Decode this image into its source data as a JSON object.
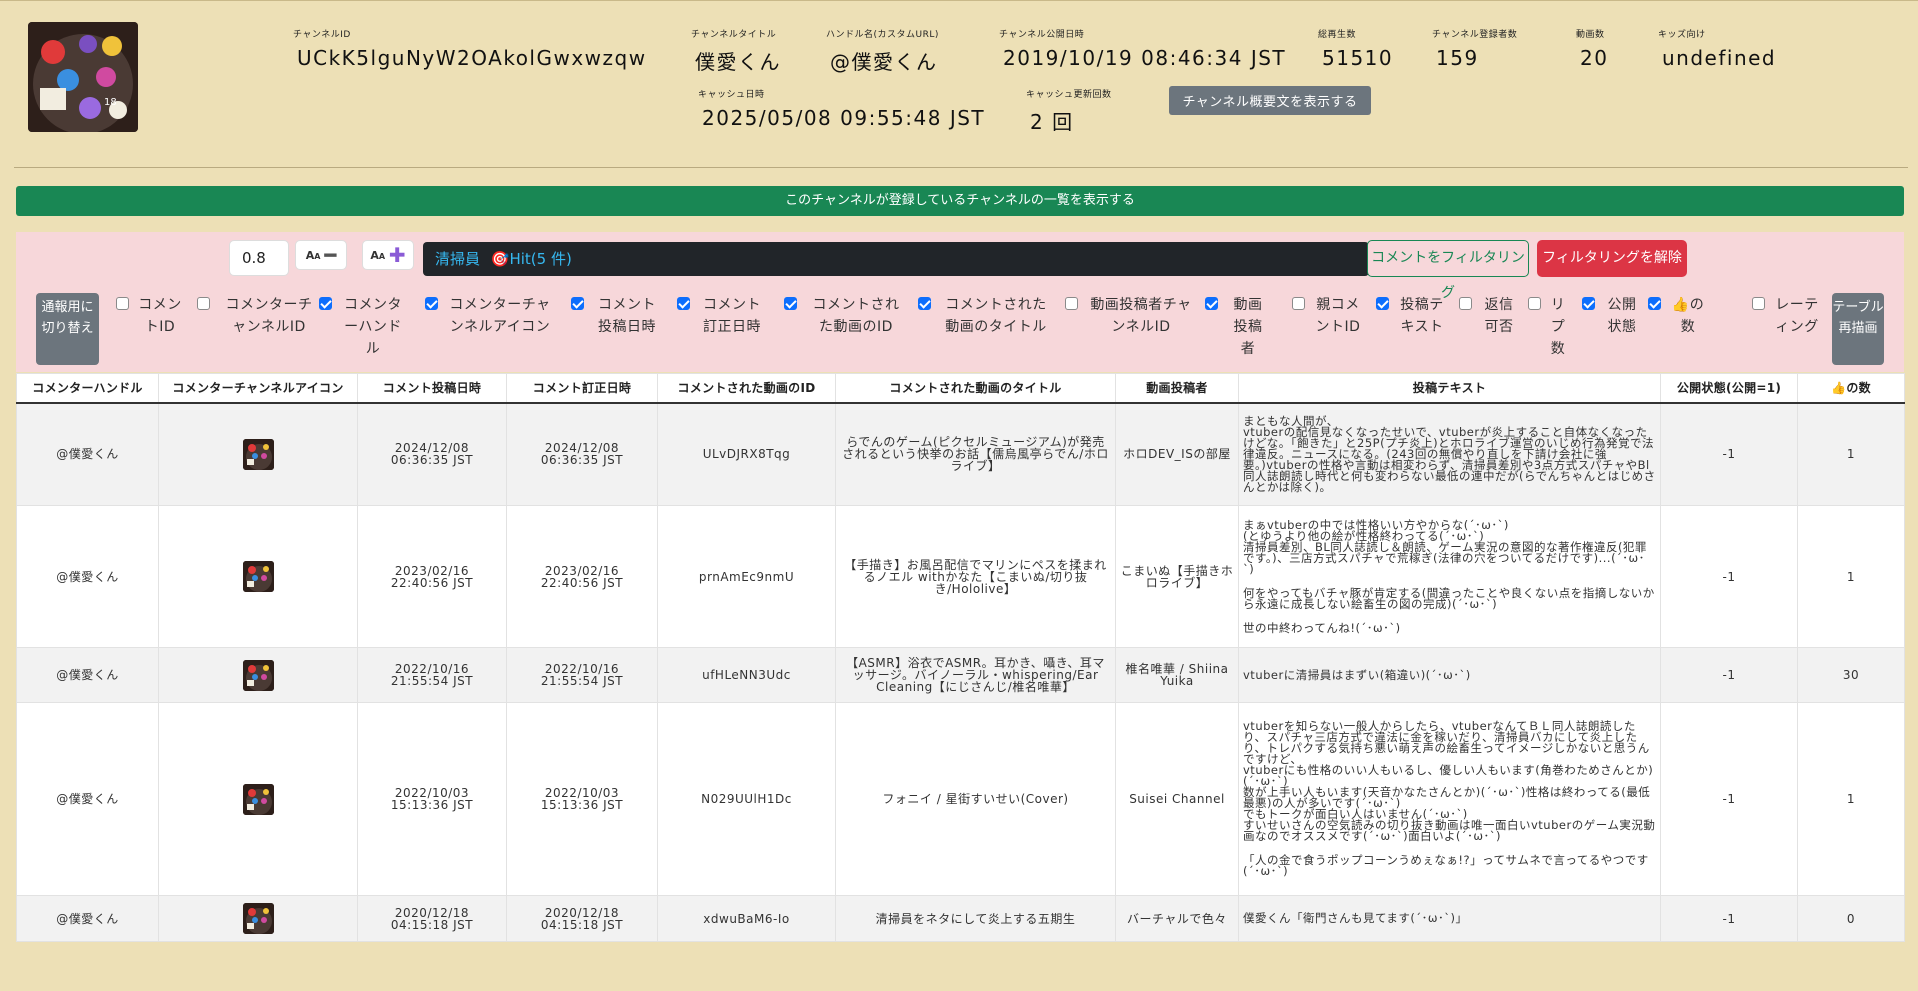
{
  "header": {
    "channel_id_label": "チャンネルID",
    "channel_id": "UCkK5lguNyW2OAkolGwxwzqw",
    "channel_title_label": "チャンネルタイトル",
    "channel_title": "僕愛くん",
    "handle_label": "ハンドル名(カスタムURL)",
    "handle": "@僕愛くん",
    "published_label": "チャンネル公開日時",
    "published": "2019/10/19 08:46:34 JST",
    "views_label": "総再生数",
    "views": "51510",
    "subscribers_label": "チャンネル登録者数",
    "subscribers": "159",
    "videos_label": "動画数",
    "videos": "20",
    "kids_label": "キッズ向け",
    "kids": "undefined",
    "cache_label": "キャッシュ日時",
    "cache": "2025/05/08 09:55:48 JST",
    "cache_count_label": "キャッシュ更新回数",
    "cache_count": "2 回",
    "desc_button": "チャンネル概要文を表示する"
  },
  "subscriptions_bar": "このチャンネルが登録しているチャンネルの一覧を表示する",
  "filter": {
    "zoom_value": "0.8",
    "font_small_label": "A",
    "font_large_label": "A",
    "search_term": "清掃員",
    "hit_text": "🎯Hit(5 件)",
    "filter_button": "コメントをフィルタリング",
    "clear_button": "フィルタリングを解除",
    "report_toggle": "通報用に切り替え",
    "redraw_button": "テーブル再描画",
    "columns": [
      {
        "label": "コメントID",
        "checked": false
      },
      {
        "label": "コメンターチャンネルID",
        "checked": false
      },
      {
        "label": "コメンターハンドル",
        "checked": true
      },
      {
        "label": "コメンターチャンネルアイコン",
        "checked": true
      },
      {
        "label": "コメント投稿日時",
        "checked": true
      },
      {
        "label": "コメント訂正日時",
        "checked": true
      },
      {
        "label": "コメントされた動画のID",
        "checked": true
      },
      {
        "label": "コメントされた動画のタイトル",
        "checked": true
      },
      {
        "label": "動画投稿者チャンネルID",
        "checked": false
      },
      {
        "label": "動画投稿者",
        "checked": true
      },
      {
        "label": "親コメントID",
        "checked": false
      },
      {
        "label": "投稿テキスト",
        "checked": true
      },
      {
        "label": "返信可否",
        "checked": false
      },
      {
        "label": "リプ数",
        "checked": false
      },
      {
        "label": "公開状態",
        "checked": true
      },
      {
        "label": "👍の数",
        "checked": true
      },
      {
        "label": "レーティング",
        "checked": false
      }
    ]
  },
  "table": {
    "headers": [
      "コメンターハンドル",
      "コメンターチャンネルアイコン",
      "コメント投稿日時",
      "コメント訂正日時",
      "コメントされた動画のID",
      "コメントされた動画のタイトル",
      "動画投稿者",
      "投稿テキスト",
      "公開状態(公開=1)",
      "👍の数"
    ],
    "rows": [
      {
        "handle": "@僕愛くん",
        "posted": [
          "2024/12/08",
          "06:36:35 JST"
        ],
        "edited": [
          "2024/12/08",
          "06:36:35 JST"
        ],
        "video_id": "ULvDJRX8Tqg",
        "video_title": "らでんのゲーム(ピクセルミュージアム)が発売されるという快挙のお話【儒烏風亭らでん/ホロライブ】",
        "uploader": "ホロDEV_ISの部屋",
        "text": [
          "まともな人間が、",
          "vtuberの配信見なくなったせいで、vtuberが炎上すること自体なくなったけどな。「飽きた」と25P(プチ炎上)とホロライブ運営のいじめ行為発覚で法律違反。ニュースになる。(243回の無償やり直しを下請け会社に強要。)vtuberの性格や言動は相変わらず、清掃員差別や3点方式スパチャやBl同人誌朗読し時代と何も変わらない最低の連中だが(らでんちゃんとはじめさんとかは除く)。"
        ],
        "status": "-1",
        "likes": "1"
      },
      {
        "handle": "@僕愛くん",
        "posted": [
          "2023/02/16",
          "22:40:56 JST"
        ],
        "edited": [
          "2023/02/16",
          "22:40:56 JST"
        ],
        "video_id": "prnAmEc9nmU",
        "video_title": "【手描き】お風呂配信でマリンにペスを揉まれるノエル withかなた【こまいぬ/切り抜き/Hololive】",
        "uploader": "こまいぬ【手描きホロライブ】",
        "text": [
          "まぁvtuberの中では性格いい方やからな(´･ω･`)",
          "(とゆうより他の絵が性格終わってる(´･ω･`)",
          "清掃員差別、BL同人誌読し＆朗読、ゲーム実況の意図的な著作権違反(犯罪です。)、三店方式スパチャで荒稼ぎ(法律の穴をついてるだけです)...(´･ω･`)",
          "",
          "何をやってもバチャ豚が肯定する(間違ったことや良くない点を指摘しないから永遠に成長しない絵畜生の図の完成)(´･ω･`)",
          "",
          "世の中終わってんね!(´･ω･`)"
        ],
        "status": "-1",
        "likes": "1"
      },
      {
        "handle": "@僕愛くん",
        "posted": [
          "2022/10/16",
          "21:55:54 JST"
        ],
        "edited": [
          "2022/10/16",
          "21:55:54 JST"
        ],
        "video_id": "ufHLeNN3Udc",
        "video_title": "【ASMR】浴衣でASMR。耳かき、囁き、耳マッサージ。バイノーラル・whispering/Ear Cleaning【にじさんじ/椎名唯華】",
        "uploader": "椎名唯華 / Shiina Yuika",
        "text": [
          "vtuberに清掃員はまずい(箱違い)(´･ω･`)"
        ],
        "status": "-1",
        "likes": "30"
      },
      {
        "handle": "@僕愛くん",
        "posted": [
          "2022/10/03",
          "15:13:36 JST"
        ],
        "edited": [
          "2022/10/03",
          "15:13:36 JST"
        ],
        "video_id": "N029UUlH1Dc",
        "video_title": "フォニイ / 星街すいせい(Cover)",
        "uploader": "Suisei Channel",
        "text": [
          "vtuberを知らない一般人からしたら、vtuberなんてＢＬ同人誌朗読したり、スパチャ三店方式で違法に金を稼いだり、清掃員バカにして炎上したり、トレパクする気持ち悪い萌え声の絵畜生ってイメージしかないと思うんですけど、",
          "vtuberにも性格のいい人もいるし、優しい人もいます(角巻わためさんとか)(´･ω･`)",
          "数が上手い人もいます(天音かなたさんとか)(´･ω･`)性格は終わってる(最低最悪)の人が多いです(´･ω･`)",
          "でもトークが面白い人はいません(´･ω･`)",
          "すいせいさんの空気読みの切り抜き動画は唯一面白いvtuberのゲーム実況動画なのでオススメです(´･ω･`)面白いよ(´･ω･`)",
          "",
          "「人の金で食うポップコーンうめぇなぁ!?」ってサムネで言ってるやつです(´･ω･`)"
        ],
        "status": "-1",
        "likes": "1"
      },
      {
        "handle": "@僕愛くん",
        "posted": [
          "2020/12/18",
          "04:15:18 JST"
        ],
        "edited": [
          "2020/12/18",
          "04:15:18 JST"
        ],
        "video_id": "xdwuBaM6-Io",
        "video_title": "清掃員をネタにして炎上する五期生",
        "uploader": "バーチャルで色々",
        "text": [
          "僕愛くん「衛門さんも見てます(´･ω･`)」"
        ],
        "status": "-1",
        "likes": "0"
      }
    ]
  },
  "colors": {
    "background": "#ede0b6",
    "subscriptions_bar": "#198754",
    "filter_panel": "#f7d7da",
    "search_box": "#212529",
    "clear_button": "#dc3545",
    "checkbox_on": "#0d6efd"
  },
  "icons": [
    "avatar-image",
    "minus-icon",
    "plus-icon",
    "target-icon"
  ]
}
